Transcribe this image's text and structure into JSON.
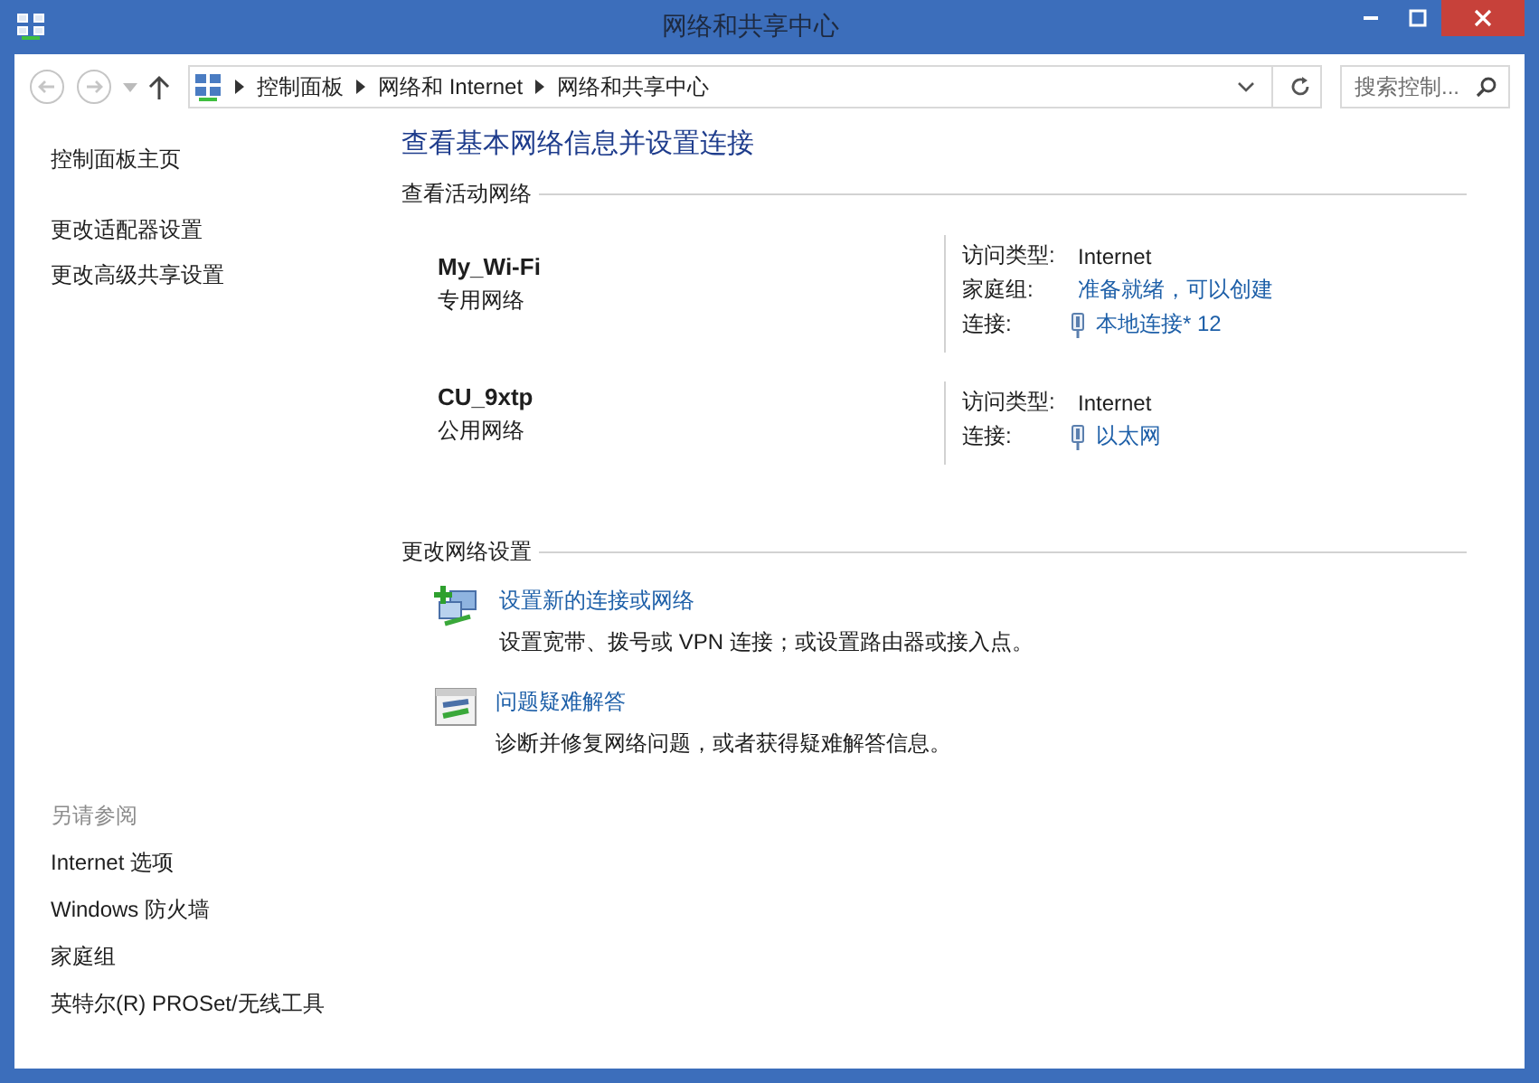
{
  "window": {
    "title": "网络和共享中心"
  },
  "address_bar": {
    "breadcrumbs": [
      "控制面板",
      "网络和 Internet",
      "网络和共享中心"
    ]
  },
  "search": {
    "placeholder": "搜索控制..."
  },
  "sidebar": {
    "items": [
      "控制面板主页",
      "更改适配器设置",
      "更改高级共享设置"
    ],
    "see_also": {
      "heading": "另请参阅",
      "items": [
        "Internet 选项",
        "Windows 防火墙",
        "家庭组",
        "英特尔(R) PROSet/无线工具"
      ]
    }
  },
  "main": {
    "title": "查看基本网络信息并设置连接",
    "active_networks_heading": "查看活动网络",
    "networks": [
      {
        "name": "My_Wi-Fi",
        "type": "专用网络",
        "properties": [
          {
            "label": "访问类型:",
            "value": "Internet",
            "kind": "text"
          },
          {
            "label": "家庭组:",
            "value": "准备就绪，可以创建",
            "kind": "link"
          },
          {
            "label": "连接:",
            "value": "本地连接* 12",
            "kind": "connection"
          }
        ]
      },
      {
        "name": "CU_9xtp",
        "type": "公用网络",
        "properties": [
          {
            "label": "访问类型:",
            "value": "Internet",
            "kind": "text"
          },
          {
            "label": "连接:",
            "value": "以太网",
            "kind": "connection"
          }
        ]
      }
    ],
    "change_settings_heading": "更改网络设置",
    "tasks": [
      {
        "kind": "new-connection",
        "link": "设置新的连接或网络",
        "description": "设置宽带、拨号或 VPN 连接；或设置路由器或接入点。"
      },
      {
        "kind": "troubleshoot",
        "link": "问题疑难解答",
        "description": "诊断并修复网络问题，或者获得疑难解答信息。"
      }
    ]
  }
}
